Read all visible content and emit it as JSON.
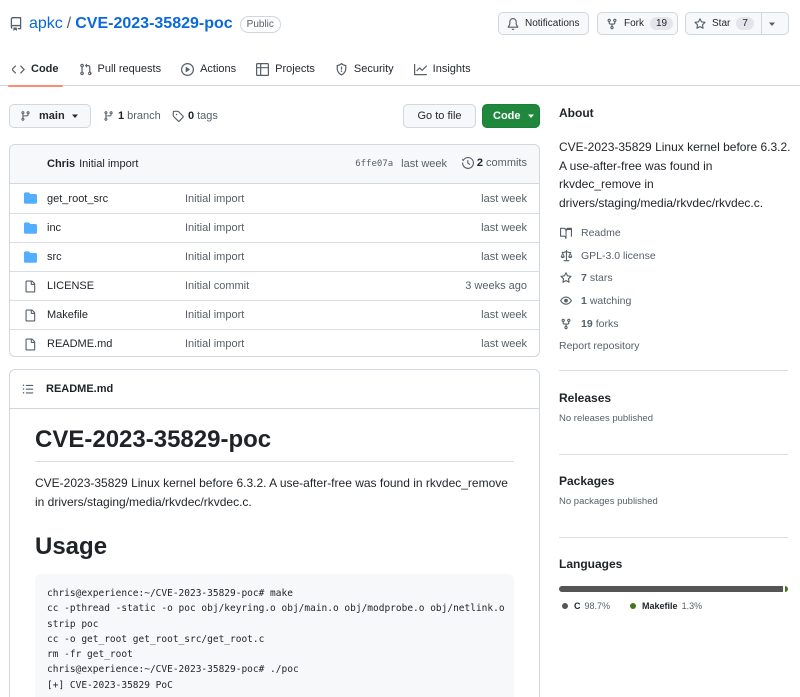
{
  "repo": {
    "owner": "apkc",
    "separator": "/",
    "name": "CVE-2023-35829-poc",
    "visibility": "Public"
  },
  "header_actions": {
    "notifications": {
      "label": "Notifications",
      "icon": "bell-icon"
    },
    "fork": {
      "label": "Fork",
      "count": "19",
      "icon": "fork-icon"
    },
    "star": {
      "label": "Star",
      "count": "7",
      "icon": "star-icon"
    }
  },
  "tabs": [
    {
      "label": "Code",
      "icon": "code-icon",
      "active": true
    },
    {
      "label": "Pull requests",
      "icon": "pull-request-icon"
    },
    {
      "label": "Actions",
      "icon": "play-icon"
    },
    {
      "label": "Projects",
      "icon": "table-icon"
    },
    {
      "label": "Security",
      "icon": "shield-icon"
    },
    {
      "label": "Insights",
      "icon": "graph-icon"
    }
  ],
  "toolbar": {
    "branch_selector": "main",
    "branches_count": "1",
    "branches_label": "branch",
    "tags_count": "0",
    "tags_label": "tags",
    "go_to_file": "Go to file",
    "code_button": "Code"
  },
  "latest_commit": {
    "author": "Chris",
    "message": "Initial import",
    "sha": "6ffe07a",
    "time": "last week",
    "commits_count": "2",
    "commits_label": "commits"
  },
  "files": [
    {
      "name": "get_root_src",
      "type": "dir",
      "message": "Initial import",
      "age": "last week"
    },
    {
      "name": "inc",
      "type": "dir",
      "message": "Initial import",
      "age": "last week"
    },
    {
      "name": "src",
      "type": "dir",
      "message": "Initial import",
      "age": "last week"
    },
    {
      "name": "LICENSE",
      "type": "file",
      "message": "Initial commit",
      "age": "3 weeks ago"
    },
    {
      "name": "Makefile",
      "type": "file",
      "message": "Initial import",
      "age": "last week"
    },
    {
      "name": "README.md",
      "type": "file",
      "message": "Initial import",
      "age": "last week"
    }
  ],
  "readme": {
    "filename": "README.md",
    "title": "CVE-2023-35829-poc",
    "description": "CVE-2023-35829 Linux kernel before 6.3.2. A use-after-free was found in rkvdec_remove in drivers/staging/media/rkvdec/rkvdec.c.",
    "usage_heading": "Usage",
    "code_lines": [
      "chris@experience:~/CVE-2023-35829-poc# make",
      "cc -pthread -static -o poc obj/keyring.o obj/main.o obj/modprobe.o obj/netlink.o",
      "strip poc",
      "cc -o get_root get_root_src/get_root.c",
      "rm -fr get_root",
      "chris@experience:~/CVE-2023-35829-poc# ./poc",
      "[+] CVE-2023-35829 PoC"
    ]
  },
  "about": {
    "heading": "About",
    "description": "CVE-2023-35829 Linux kernel before 6.3.2. A use-after-free was found in rkvdec_remove in drivers/staging/media/rkvdec/rkvdec.c.",
    "readme": "Readme",
    "license": "GPL-3.0 license",
    "stars_count": "7",
    "stars_label": "stars",
    "watching_count": "1",
    "watching_label": "watching",
    "forks_count": "19",
    "forks_label": "forks",
    "report": "Report repository"
  },
  "releases": {
    "heading": "Releases",
    "empty": "No releases published"
  },
  "packages": {
    "heading": "Packages",
    "empty": "No packages published"
  },
  "languages": {
    "heading": "Languages",
    "items": [
      {
        "name": "C",
        "percent": "98.7%",
        "value": 98.7,
        "color": "#555555"
      },
      {
        "name": "Makefile",
        "percent": "1.3%",
        "value": 1.3,
        "color": "#427819"
      }
    ]
  },
  "colors": {
    "link": "#0969da",
    "primary_button": "#1f883d",
    "tab_underline": "#fd8c73",
    "folder": "#54aeff"
  }
}
